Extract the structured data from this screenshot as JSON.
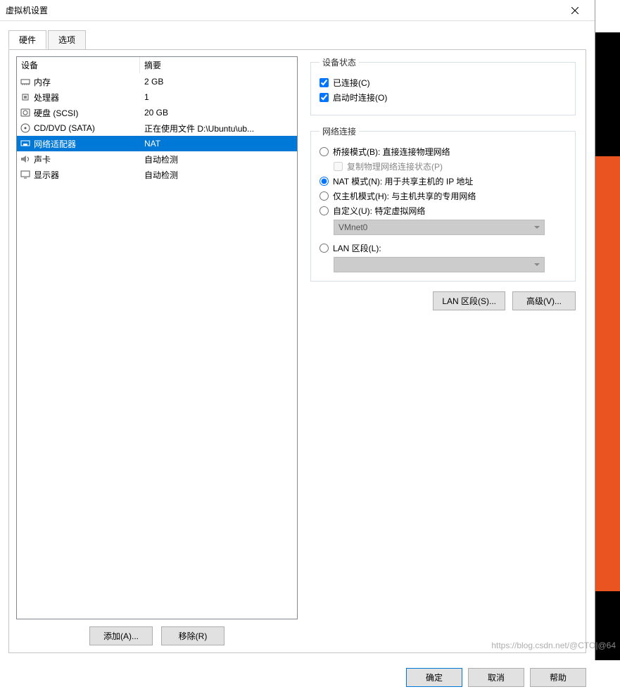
{
  "window": {
    "title": "虚拟机设置"
  },
  "tabs": {
    "hardware": "硬件",
    "options": "选项"
  },
  "table": {
    "col_device": "设备",
    "col_summary": "摘要",
    "rows": [
      {
        "name": "内存",
        "summary": "2 GB",
        "icon": "memory"
      },
      {
        "name": "处理器",
        "summary": "1",
        "icon": "cpu"
      },
      {
        "name": "硬盘 (SCSI)",
        "summary": "20 GB",
        "icon": "hdd"
      },
      {
        "name": "CD/DVD (SATA)",
        "summary": "正在使用文件 D:\\Ubuntu\\ub...",
        "icon": "cd"
      },
      {
        "name": "网络适配器",
        "summary": "NAT",
        "icon": "nic",
        "selected": true
      },
      {
        "name": "声卡",
        "summary": "自动检测",
        "icon": "sound"
      },
      {
        "name": "显示器",
        "summary": "自动检测",
        "icon": "monitor"
      }
    ]
  },
  "left_buttons": {
    "add": "添加(A)...",
    "remove": "移除(R)"
  },
  "device_state": {
    "legend": "设备状态",
    "connected": "已连接(C)",
    "connect_at_poweron": "启动时连接(O)",
    "connected_checked": true,
    "poweron_checked": true
  },
  "net": {
    "legend": "网络连接",
    "bridged": "桥接模式(B): 直接连接物理网络",
    "replicate": "复制物理网络连接状态(P)",
    "nat": "NAT 模式(N): 用于共享主机的 IP 地址",
    "hostonly": "仅主机模式(H): 与主机共享的专用网络",
    "custom": "自定义(U): 特定虚拟网络",
    "custom_select": "VMnet0",
    "lan_segment": "LAN 区段(L):",
    "selected": "nat"
  },
  "right_buttons": {
    "lan_segments": "LAN 区段(S)...",
    "advanced": "高级(V)..."
  },
  "footer": {
    "ok": "确定",
    "cancel": "取消",
    "help": "帮助"
  },
  "watermark": "https://blog.csdn.net/@CTO|@64"
}
